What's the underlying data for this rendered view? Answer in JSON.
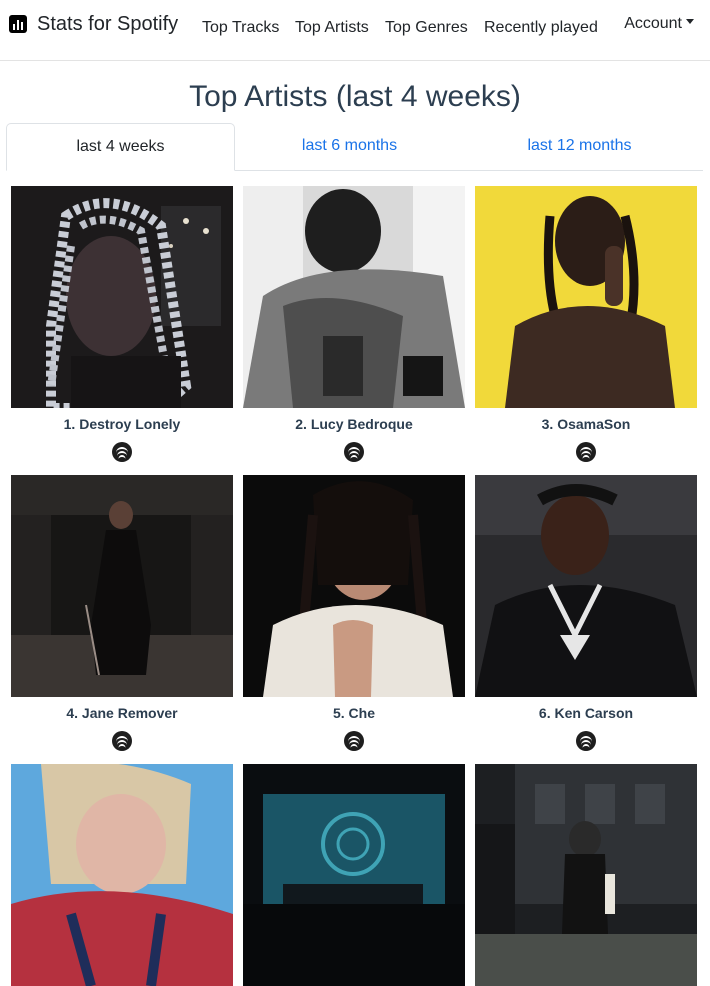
{
  "nav": {
    "brand": "Stats for Spotify",
    "links": [
      "Top Tracks",
      "Top Artists",
      "Top Genres",
      "Recently played"
    ],
    "account": "Account"
  },
  "page": {
    "title": "Top Artists (last 4 weeks)"
  },
  "tabs": [
    {
      "label": "last 4 weeks",
      "active": true
    },
    {
      "label": "last 6 months",
      "active": false
    },
    {
      "label": "last 12 months",
      "active": false
    }
  ],
  "artists": [
    {
      "label": "1. Destroy Lonely"
    },
    {
      "label": "2. Lucy Bedroque"
    },
    {
      "label": "3. OsamaSon"
    },
    {
      "label": "4. Jane Remover"
    },
    {
      "label": "5. Che"
    },
    {
      "label": "6. Ken Carson"
    },
    {
      "label": ""
    },
    {
      "label": ""
    },
    {
      "label": ""
    }
  ],
  "icons": {
    "brand": "bar-chart-icon",
    "link": "spotify-icon"
  },
  "colors": {
    "link": "#1a73e8",
    "title": "#2c3e50",
    "photo_yellow": "#f1d93a"
  }
}
